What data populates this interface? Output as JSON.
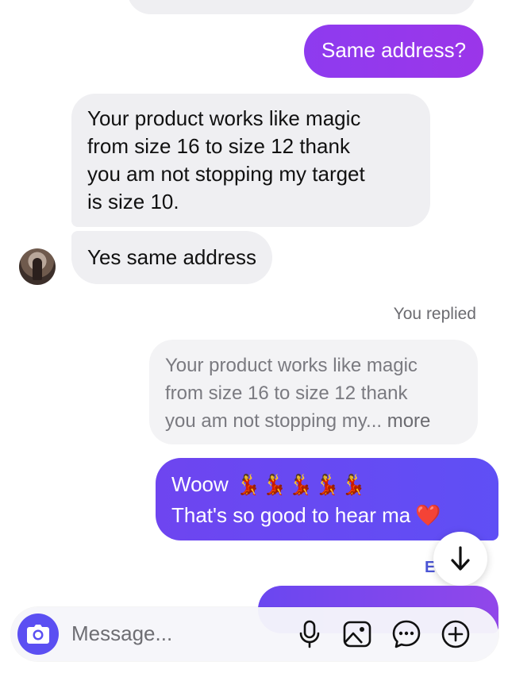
{
  "messages": [
    {
      "id": "b1",
      "text": "Same address?"
    },
    {
      "id": "b2",
      "text": "Your product works like magic\nfrom size  16  to size  12  thank\nyou am not stopping my target\nis size 10."
    },
    {
      "id": "b3",
      "text": "Yes same address"
    }
  ],
  "reply_label": "You replied",
  "quoted": {
    "text": "Your product works like magic\nfrom size  16  to size  12  thank\nyou am not stopping my...",
    "more": " more"
  },
  "outgoing": {
    "line1": "Woow",
    "line2": "That's so good to hear ma",
    "dancer_count": 5
  },
  "seen_letter": "E",
  "composer": {
    "placeholder": "Message..."
  },
  "icons": {
    "avatar": "contact-avatar",
    "scroll": "arrow-down-icon",
    "camera": "camera-icon",
    "mic": "microphone-icon",
    "gallery": "image-icon",
    "sticker": "chat-bubble-icon",
    "add": "plus-circle-icon"
  },
  "colors": {
    "accent": "#5b4ff2",
    "outgoing_start": "#8e3bef",
    "incoming_bg": "#efeff2"
  }
}
